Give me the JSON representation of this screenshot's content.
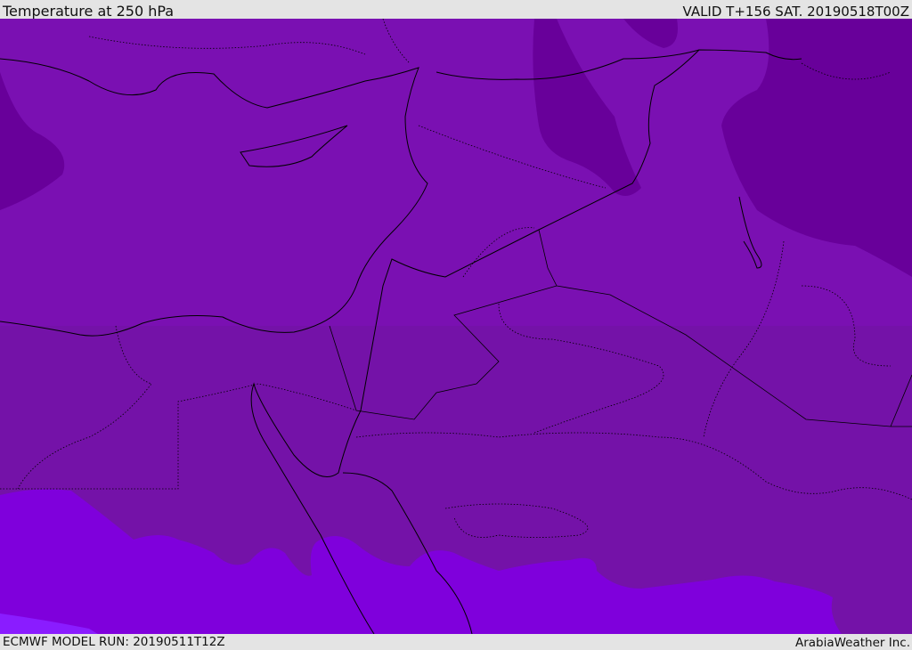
{
  "header": {
    "title": "Temperature at 250 hPa",
    "valid": "VALID T+156 SAT. 20190518T00Z"
  },
  "footer": {
    "model_run": "ECMWF MODEL RUN: 20190511T12Z",
    "credit": "ArabiaWeather Inc."
  },
  "colors": {
    "base": "#7a10b2",
    "lower": "#7412a8",
    "cold": "#68009a",
    "warm": "#7f00dc",
    "warmer": "#8a1cff",
    "border": "#000000"
  }
}
